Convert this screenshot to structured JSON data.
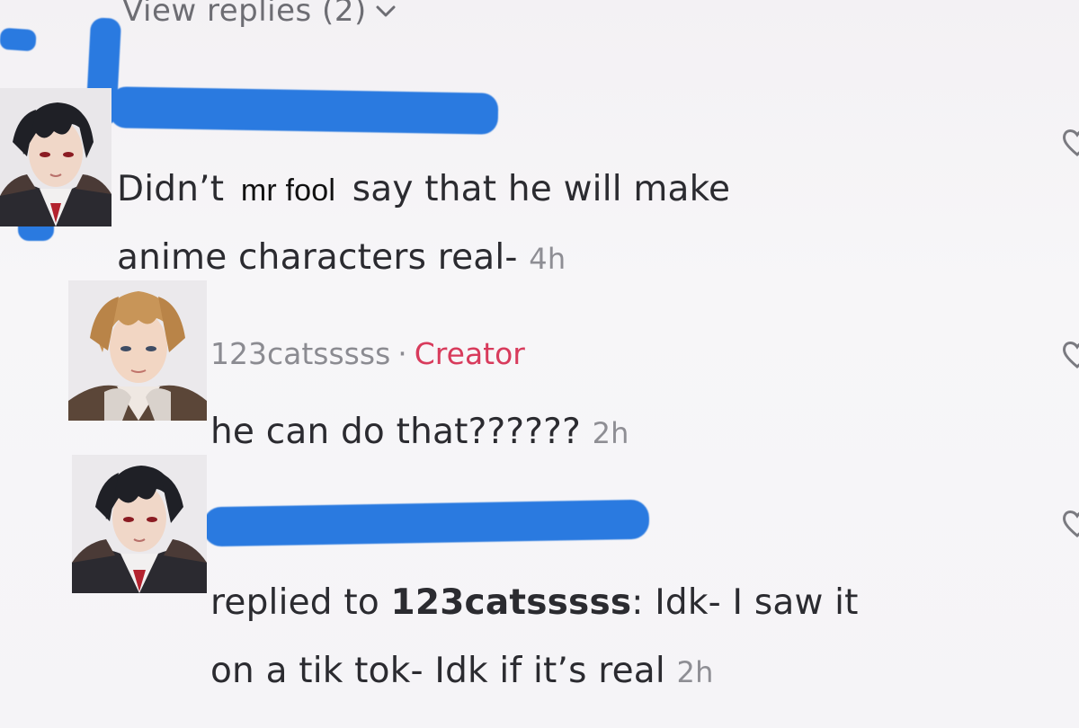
{
  "thread": {
    "view_replies_label": "View replies (2)"
  },
  "comments": [
    {
      "text_line1_before": "Didn’t",
      "inserted_name": "mr fool",
      "text_line1_after": "say that he will make",
      "text_line2": "anime characters real-",
      "time": "4h"
    },
    {
      "username": "123catsssss",
      "separator": "·",
      "badge": "Creator",
      "text": "he can do that??????",
      "time": "2h"
    },
    {
      "prefix": "replied to",
      "reply_to": "123catsssss",
      "text_line1": ": Idk- I saw it",
      "text_line2": "on a tik tok- Idk if it’s real",
      "time": "2h"
    }
  ],
  "icons": {
    "chevron": "chevron-down-icon",
    "heart": "heart-outline-icon"
  },
  "colors": {
    "scribble_blue": "#2a7ae0",
    "creator_pink": "#d83b5c",
    "muted_gray": "#8b8b91"
  }
}
